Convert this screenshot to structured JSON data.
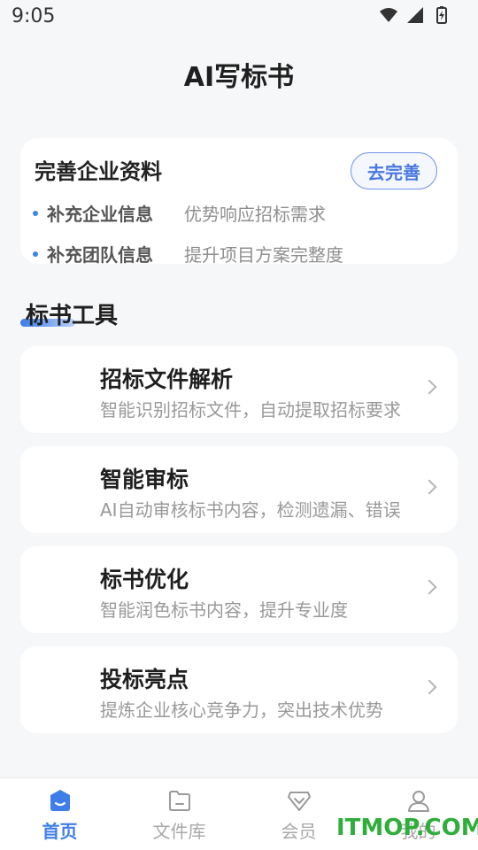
{
  "status_bar": {
    "time": "9:05"
  },
  "app_title": "AI写标书",
  "profile_card": {
    "title": "完善企业资料",
    "button_label": "去完善",
    "items": [
      {
        "label": "补充企业信息",
        "desc": "优势响应招标需求"
      },
      {
        "label": "补充团队信息",
        "desc": "提升项目方案完整度"
      }
    ]
  },
  "section": {
    "title": "标书工具"
  },
  "tools": [
    {
      "name": "招标文件解析",
      "desc": "智能识别招标文件，自动提取招标要求"
    },
    {
      "name": "智能审标",
      "desc": "AI自动审核标书内容，检测遗漏、错误"
    },
    {
      "name": "标书优化",
      "desc": "智能润色标书内容，提升专业度"
    },
    {
      "name": "投标亮点",
      "desc": "提炼企业核心竞争力，突出技术优势"
    }
  ],
  "bottom_nav": {
    "items": [
      {
        "label": "首页",
        "icon": "home-icon",
        "active": true
      },
      {
        "label": "文件库",
        "icon": "folder-icon",
        "active": false
      },
      {
        "label": "会员",
        "icon": "vip-icon",
        "active": false
      },
      {
        "label": "我的",
        "icon": "profile-icon",
        "active": false
      }
    ]
  },
  "watermark": "ITMOP.COM",
  "colors": {
    "accent": "#3f7ee8",
    "watermark": "#2fae3c"
  }
}
